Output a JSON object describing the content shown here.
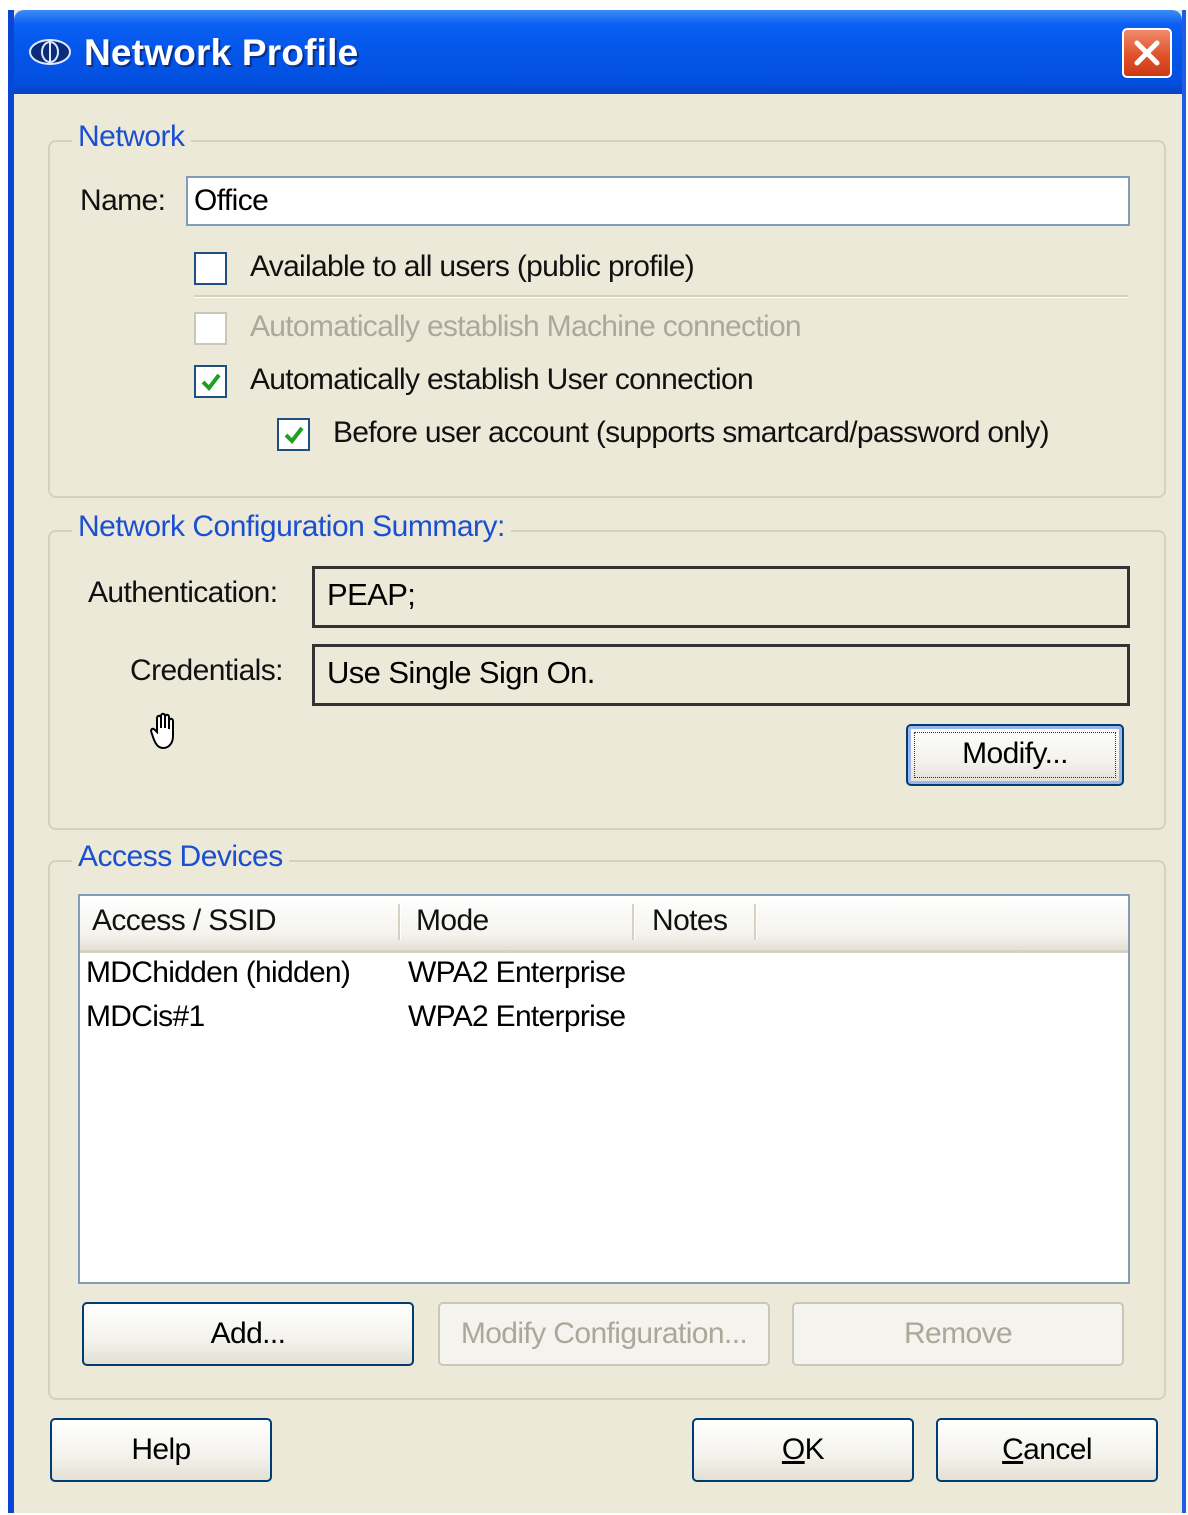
{
  "window": {
    "title": "Network Profile",
    "close_icon": "close-icon"
  },
  "network": {
    "legend": "Network",
    "name_label": "Name:",
    "name_value": "Office",
    "checkboxes": [
      {
        "label": "Available to all users (public profile)",
        "checked": false,
        "enabled": true
      },
      {
        "label": "Automatically establish Machine connection",
        "checked": false,
        "enabled": false
      },
      {
        "label": "Automatically establish User connection",
        "checked": true,
        "enabled": true
      },
      {
        "label": "Before user account (supports smartcard/password only)",
        "checked": true,
        "enabled": true
      }
    ]
  },
  "summary": {
    "legend": "Network Configuration Summary:",
    "authentication_label": "Authentication:",
    "authentication_value": "PEAP;",
    "credentials_label": "Credentials:",
    "credentials_value": "Use Single Sign On.",
    "modify_button": "Modify..."
  },
  "access_devices": {
    "legend": "Access Devices",
    "columns": [
      "Access / SSID",
      "Mode",
      "Notes"
    ],
    "rows": [
      {
        "ssid": "MDChidden (hidden)",
        "mode": "WPA2 Enterprise",
        "notes": ""
      },
      {
        "ssid": "MDCis#1",
        "mode": "WPA2 Enterprise",
        "notes": ""
      }
    ],
    "add_button": "Add...",
    "modify_config_button": "Modify Configuration...",
    "remove_button": "Remove"
  },
  "footer": {
    "help_button": "Help",
    "ok_button_rest": "K",
    "ok_button_mnemonic": "O",
    "cancel_button_rest": "ancel",
    "cancel_button_mnemonic": "C"
  },
  "colors": {
    "titlebar": "#0356e8",
    "legend_text": "#1a4fd0",
    "dialog_bg": "#ece9d8",
    "check_green": "#21a121"
  }
}
